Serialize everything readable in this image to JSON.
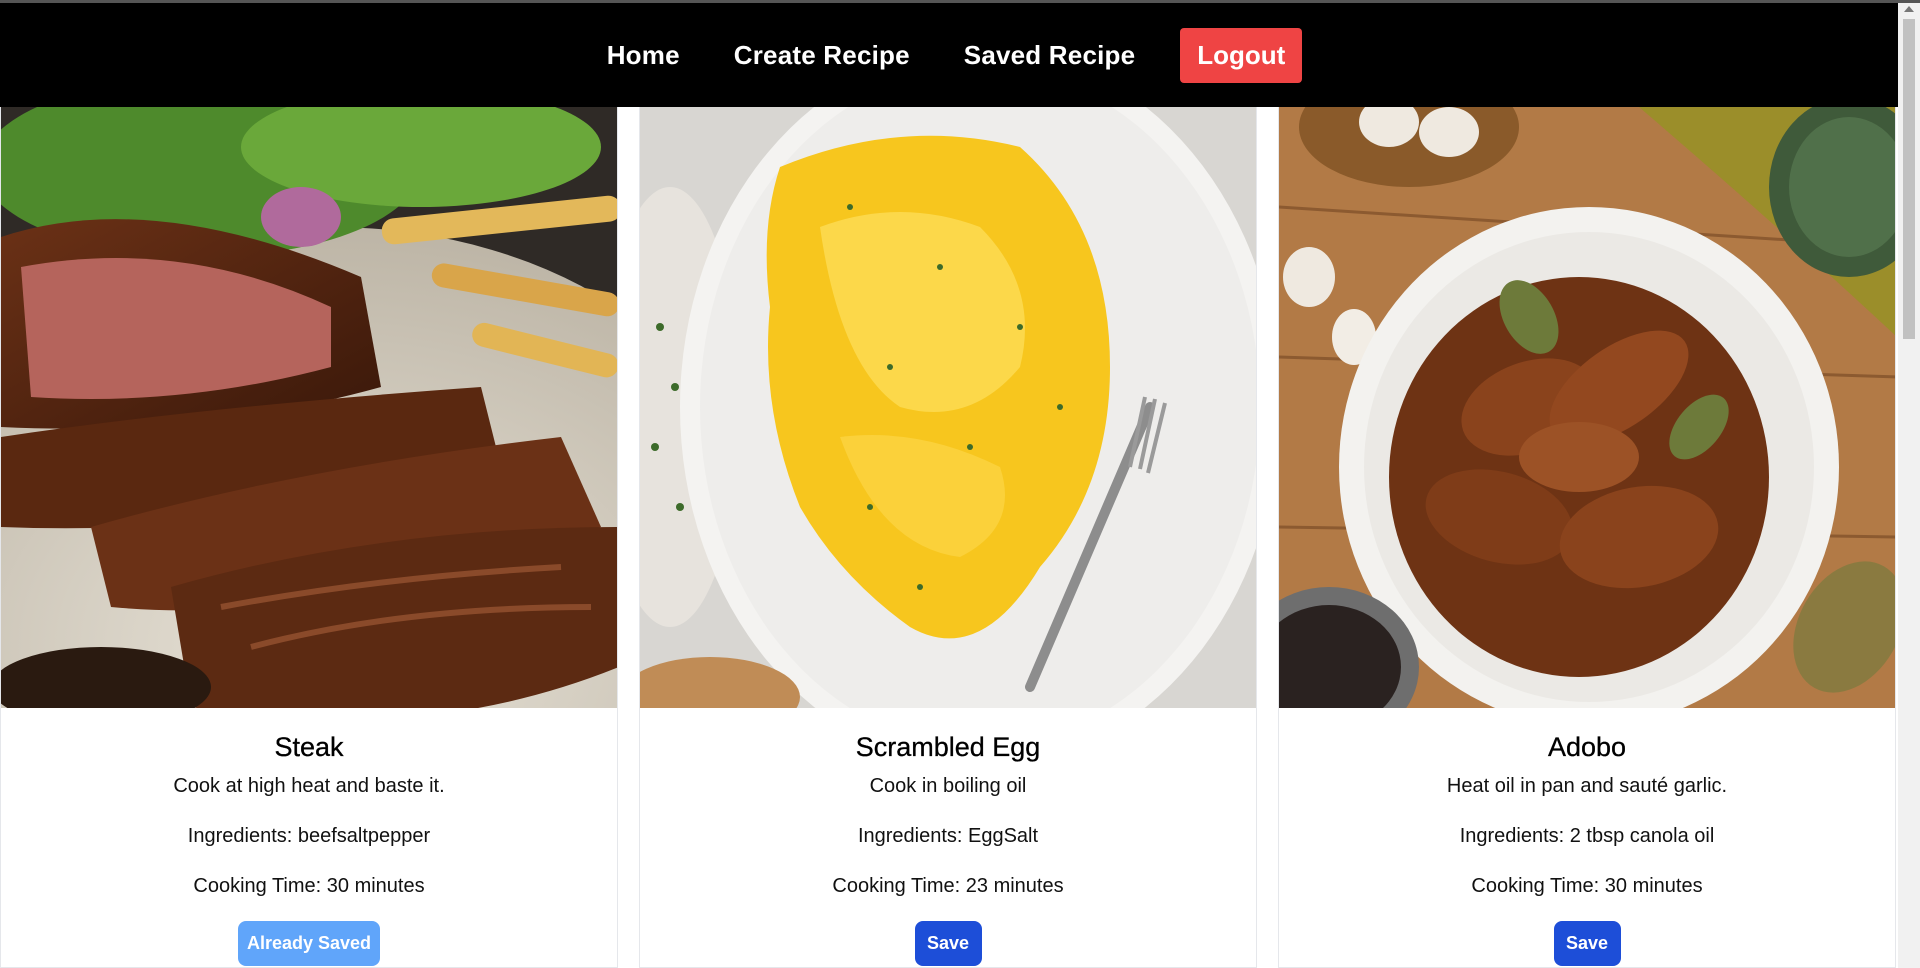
{
  "nav": {
    "home": "Home",
    "create": "Create Recipe",
    "saved": "Saved Recipe",
    "logout": "Logout",
    "logout_color": "#ef4444"
  },
  "recipes": [
    {
      "name": "Steak",
      "instructions": "Cook at high heat and baste it.",
      "ingredients": "Ingredients: beefsaltpepper",
      "cooking_time": "Cooking Time: 30 minutes",
      "button": "Already Saved",
      "button_color": "#60a5fa"
    },
    {
      "name": "Scrambled Egg",
      "instructions": "Cook in boiling oil",
      "ingredients": "Ingredients: EggSalt",
      "cooking_time": "Cooking Time: 23 minutes",
      "button": "Save",
      "button_color": "#1d4ed8"
    },
    {
      "name": "Adobo",
      "instructions": "Heat oil in pan and sauté garlic.",
      "ingredients": "Ingredients: 2 tbsp canola oil",
      "cooking_time": "Cooking Time: 30 minutes",
      "button": "Save",
      "button_color": "#1d4ed8"
    }
  ]
}
